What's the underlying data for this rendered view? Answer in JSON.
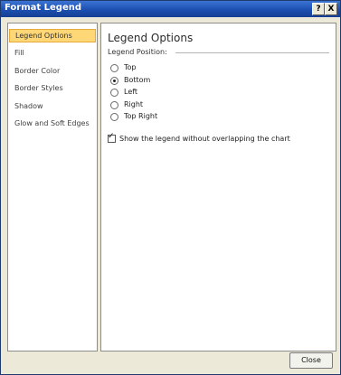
{
  "window": {
    "title": "Format Legend",
    "help_label": "?",
    "close_label": "X"
  },
  "sidebar": {
    "items": [
      {
        "label": "Legend Options"
      },
      {
        "label": "Fill"
      },
      {
        "label": "Border Color"
      },
      {
        "label": "Border Styles"
      },
      {
        "label": "Shadow"
      },
      {
        "label": "Glow and Soft Edges"
      }
    ]
  },
  "main": {
    "title": "Legend Options",
    "section_label": "Legend Position:",
    "positions": [
      {
        "label": "Top",
        "selected": false
      },
      {
        "label": "Bottom",
        "selected": true
      },
      {
        "label": "Left",
        "selected": false
      },
      {
        "label": "Right",
        "selected": false
      },
      {
        "label": "Top Right",
        "selected": false
      }
    ],
    "overlap_checkbox": {
      "label": "Show the legend without overlapping the chart",
      "checked": true
    }
  },
  "footer": {
    "close_label": "Close"
  }
}
